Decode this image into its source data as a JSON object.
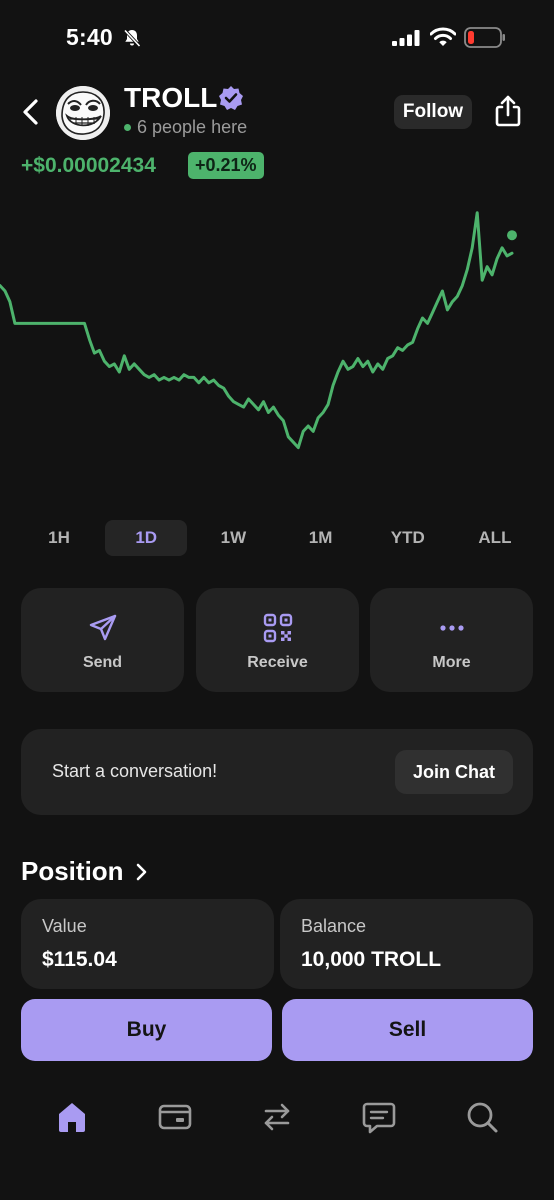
{
  "status_bar": {
    "time": "5:40"
  },
  "header": {
    "token_name": "TROLL",
    "presence": "6 people here",
    "follow_label": "Follow"
  },
  "price": {
    "change": "+$0.00002434",
    "change_pct": "+0.21%"
  },
  "chart_data": {
    "type": "line",
    "color": "#4db36c",
    "x": [
      0,
      1,
      2,
      3,
      4,
      5,
      6,
      7,
      8,
      9,
      10,
      11,
      12,
      13,
      14,
      15,
      16,
      17,
      18,
      19,
      20,
      21,
      22,
      23,
      24,
      25,
      26,
      27,
      28,
      29,
      30,
      31,
      32,
      33,
      34,
      35,
      36,
      37,
      38,
      39,
      40,
      41,
      42,
      43,
      44,
      45,
      46,
      47,
      48,
      49,
      50,
      51,
      52,
      53,
      54,
      55,
      56,
      57,
      58,
      59,
      60,
      61,
      62,
      63,
      64,
      65,
      66,
      67,
      68,
      69,
      70,
      71,
      72,
      73,
      74,
      75,
      76,
      77,
      78,
      79,
      80,
      81,
      82,
      83,
      84,
      85,
      86,
      87,
      88,
      89,
      90,
      91,
      92,
      93,
      94,
      95,
      96,
      97,
      98,
      99,
      100,
      101,
      102,
      103
    ],
    "values": [
      72,
      70,
      66,
      58,
      58,
      58,
      58,
      58,
      58,
      58,
      58,
      58,
      58,
      58,
      58,
      58,
      58,
      58,
      52,
      47,
      48,
      44,
      42,
      43,
      40,
      46,
      41,
      43,
      41,
      39,
      38,
      39,
      37,
      38,
      37,
      38,
      37,
      39,
      38,
      38,
      36,
      38,
      36,
      37,
      35,
      34,
      31,
      29,
      28,
      27,
      30,
      28,
      26,
      29,
      25,
      27,
      24,
      22,
      16,
      14,
      12,
      18,
      20,
      18,
      23,
      25,
      28,
      35,
      40,
      44,
      41,
      42,
      45,
      42,
      44,
      40,
      43,
      41,
      45,
      46,
      49,
      48,
      50,
      51,
      56,
      60,
      58,
      62,
      66,
      70,
      63,
      66,
      68,
      72,
      78,
      86,
      99,
      74,
      79,
      76,
      82,
      86,
      83,
      84
    ],
    "ylim": [
      0,
      100
    ],
    "grid": false,
    "legend": "none"
  },
  "ranges": [
    "1H",
    "1D",
    "1W",
    "1M",
    "YTD",
    "ALL"
  ],
  "active_range": "1D",
  "actions": {
    "send": {
      "label": "Send",
      "icon": "send-icon"
    },
    "receive": {
      "label": "Receive",
      "icon": "qr-code-icon"
    },
    "more": {
      "label": "More",
      "icon": "more-dots-icon"
    }
  },
  "chat": {
    "prompt": "Start a conversation!",
    "join_label": "Join Chat"
  },
  "position": {
    "title": "Position",
    "value_label": "Value",
    "value": "$115.04",
    "balance_label": "Balance",
    "balance": "10,000 TROLL"
  },
  "trade": {
    "buy_label": "Buy",
    "sell_label": "Sell"
  },
  "tab_bar": [
    "home-icon",
    "wallet-icon",
    "swap-icon",
    "chat-icon",
    "search-icon"
  ],
  "colors": {
    "accent": "#a99bf2",
    "positive": "#4db36c",
    "background": "#121212",
    "card": "#222222"
  }
}
